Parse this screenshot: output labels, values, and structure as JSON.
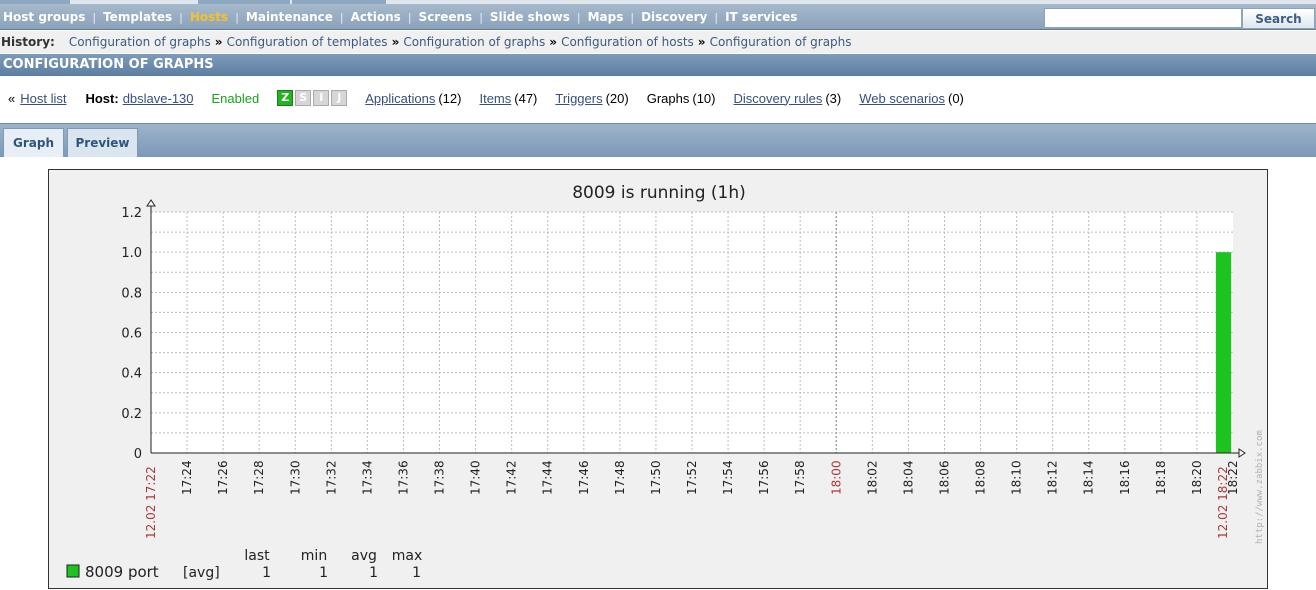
{
  "nav": {
    "items": [
      "Host groups",
      "Templates",
      "Hosts",
      "Maintenance",
      "Actions",
      "Screens",
      "Slide shows",
      "Maps",
      "Discovery",
      "IT services"
    ],
    "active_index": 2,
    "search_value": "",
    "search_button": "Search"
  },
  "history": {
    "label": "History:",
    "links": [
      "Configuration of graphs",
      "Configuration of templates",
      "Configuration of graphs",
      "Configuration of hosts",
      "Configuration of graphs"
    ],
    "separator": "»"
  },
  "page_title": "CONFIGURATION OF GRAPHS",
  "host": {
    "back_prefix": "«",
    "back_link": "Host list",
    "host_label": "Host:",
    "host_name": "dbslave-130",
    "status": "Enabled",
    "availability_icons": [
      "Z",
      "S",
      "I",
      "J"
    ],
    "links": [
      {
        "label": "Applications",
        "count": "(12)",
        "linked": true
      },
      {
        "label": "Items",
        "count": "(47)",
        "linked": true
      },
      {
        "label": "Triggers",
        "count": "(20)",
        "linked": true
      },
      {
        "label": "Graphs",
        "count": "(10)",
        "linked": false
      },
      {
        "label": "Discovery rules",
        "count": "(3)",
        "linked": true
      },
      {
        "label": "Web scenarios",
        "count": "(0)",
        "linked": true
      }
    ]
  },
  "tabs": [
    "Graph",
    "Preview"
  ],
  "active_tab": 1,
  "chart_data": {
    "type": "bar",
    "title": "8009 is running (1h)",
    "y_ticks": [
      "0",
      "0.2",
      "0.4",
      "0.6",
      "0.8",
      "1.0",
      "1.2"
    ],
    "ylim": [
      0,
      1.2
    ],
    "x_start_label": "12.02 17:22",
    "x_end_label": "12.02 18:22",
    "x_ticks": [
      "17:24",
      "17:26",
      "17:28",
      "17:30",
      "17:32",
      "17:34",
      "17:36",
      "17:38",
      "17:40",
      "17:42",
      "17:44",
      "17:46",
      "17:48",
      "17:50",
      "17:52",
      "17:54",
      "17:56",
      "17:58",
      "18:00",
      "18:02",
      "18:04",
      "18:06",
      "18:08",
      "18:10",
      "18:12",
      "18:14",
      "18:16",
      "18:18",
      "18:20",
      "18:22"
    ],
    "x_highlight_tick": "18:00",
    "grid": true,
    "series": [
      {
        "name": "8009 port",
        "color": "#1ec41e",
        "func": "[avg]",
        "x": [
          "18:21:30",
          "18:22"
        ],
        "values": [
          1,
          1
        ],
        "last": "1",
        "min": "1",
        "avg": "1",
        "max": "1"
      }
    ],
    "legend_headers": [
      "last",
      "min",
      "avg",
      "max"
    ],
    "watermark": "http://www.zabbix.com"
  }
}
